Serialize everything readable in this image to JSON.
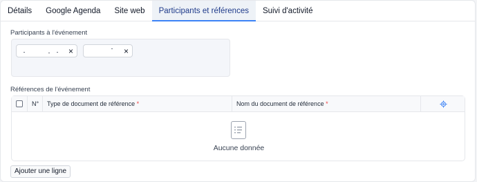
{
  "tabs": [
    {
      "label": "Détails"
    },
    {
      "label": "Google Agenda"
    },
    {
      "label": "Site web"
    },
    {
      "label": "Participants et références",
      "active": true
    },
    {
      "label": "Suivi d'activité"
    }
  ],
  "participants": {
    "label": "Participants à l'événement",
    "chips": [
      {
        "remove_icon": "×"
      },
      {
        "remove_icon": "×"
      }
    ]
  },
  "references": {
    "label": "Références de l'événement",
    "columns": {
      "number": "N°",
      "doc_type": "Type de document de référence",
      "doc_name": "Nom du document de référence",
      "required_marker": "*"
    },
    "settings_icon": "settings-icon",
    "empty_icon": "empty-document-icon",
    "empty_text": "Aucune donnée"
  },
  "actions": {
    "add_row": "Ajouter une ligne"
  },
  "colors": {
    "active_tab_text": "#1e3a8a",
    "active_tab_underline": "#3b82f6",
    "required": "#ef4444",
    "settings_icon": "#3b82f6"
  }
}
